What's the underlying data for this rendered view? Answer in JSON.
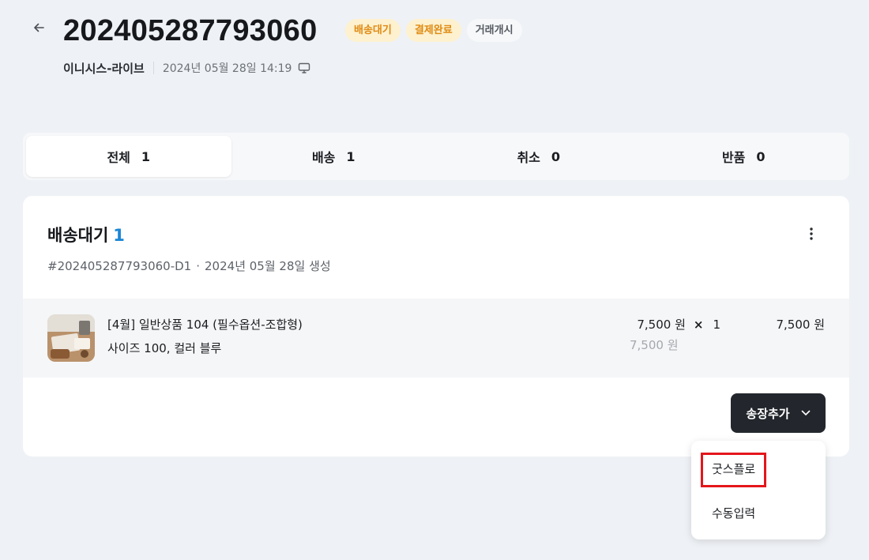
{
  "header": {
    "order_number": "202405287793060",
    "badges": [
      "배송대기",
      "결제완료",
      "거래개시"
    ],
    "store_name": "이니시스-라이브",
    "order_datetime": "2024년 05월 28일 14:19"
  },
  "tabs": [
    {
      "label": "전체",
      "count": "1"
    },
    {
      "label": "배송",
      "count": "1"
    },
    {
      "label": "취소",
      "count": "0"
    },
    {
      "label": "반품",
      "count": "0"
    }
  ],
  "group": {
    "title": "배송대기",
    "count": "1",
    "shipment_id": "#202405287793060-D1",
    "created_text": "2024년 05월 28일 생성"
  },
  "product": {
    "name": "[4월] 일반상품 104 (필수옵션-조합형)",
    "option": "사이즈 100, 컬러 블루",
    "unit_price": "7,500 원",
    "times": "×",
    "quantity": "1",
    "original_price": "7,500 원",
    "total_price": "7,500 원"
  },
  "actions": {
    "add_invoice_label": "송장추가",
    "dropdown_items": [
      "굿스플로",
      "수동입력"
    ]
  },
  "colors": {
    "background": "#eef1f5",
    "accent_blue": "#1a85d6",
    "badge_warn_bg": "#fdf1cf",
    "badge_warn_text": "#e08a12",
    "dark_button": "#23272d",
    "highlight_red": "#e4161b"
  },
  "icons": {
    "back": "arrow-left-icon",
    "device": "monitor-icon",
    "more": "more-vertical-icon",
    "chevron": "chevron-down-icon"
  }
}
